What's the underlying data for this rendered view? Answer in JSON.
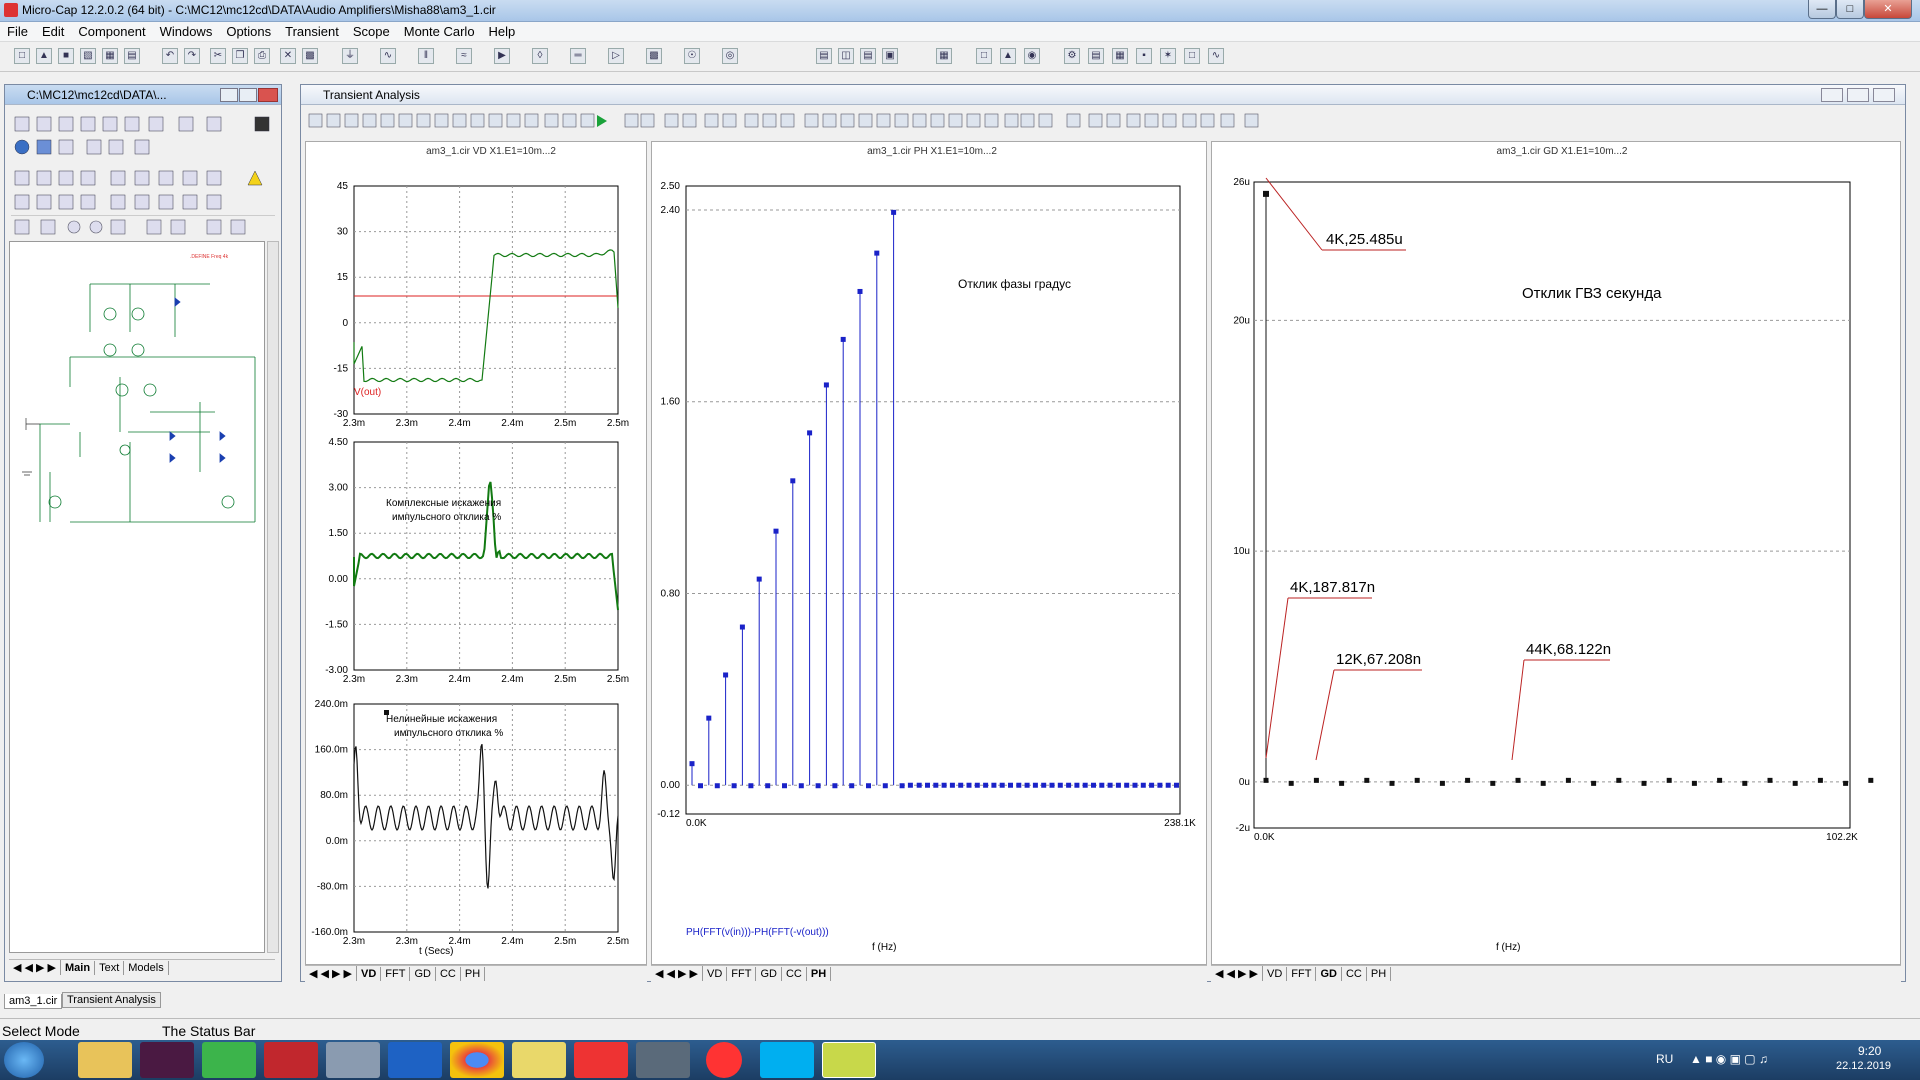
{
  "window": {
    "title": "Micro-Cap 12.2.0.2 (64 bit) - C:\\MC12\\mc12cd\\DATA\\Audio Amplifiers\\Misha88\\am3_1.cir"
  },
  "menu": [
    "File",
    "Edit",
    "Component",
    "Windows",
    "Options",
    "Transient",
    "Scope",
    "Monte Carlo",
    "Help"
  ],
  "schematic_window": {
    "title": "C:\\MC12\\mc12cd\\DATA\\...",
    "tabs": [
      "Main",
      "Text",
      "Models"
    ]
  },
  "transient_window": {
    "title": "Transient Analysis"
  },
  "plots": {
    "vd": {
      "title": "am3_1.cir VD X1.E1=10m...2",
      "y_ticks": [
        "45",
        "30",
        "15",
        "0",
        "-15",
        "-30"
      ],
      "x_ticks": [
        "2.3m",
        "2.3m",
        "2.4m",
        "2.4m",
        "2.5m",
        "2.5m"
      ],
      "trace_label": "V(out)"
    },
    "complex": {
      "annotation_line1": "Комплексные искажения",
      "annotation_line2": "импульсного отклика %",
      "y_ticks": [
        "4.50",
        "3.00",
        "1.50",
        "0.00",
        "-1.50",
        "-3.00"
      ],
      "x_ticks": [
        "2.3m",
        "2.3m",
        "2.4m",
        "2.4m",
        "2.5m",
        "2.5m"
      ]
    },
    "nonlinear": {
      "annotation_line1": "Нелинейные искажения",
      "annotation_line2": "импульсного отклика %",
      "y_ticks": [
        "240.0m",
        "160.0m",
        "80.0m",
        "0.0m",
        "-80.0m",
        "-160.0m"
      ],
      "x_ticks": [
        "2.3m",
        "2.3m",
        "2.4m",
        "2.4m",
        "2.5m",
        "2.5m"
      ],
      "xlabel": "t (Secs)"
    },
    "ph": {
      "title": "am3_1.cir PH X1.E1=10m...2",
      "y_ticks": [
        "2.50",
        "2.40",
        "1.60",
        "0.80",
        "0.00",
        "-0.12"
      ],
      "x_ticks": [
        "0.0K",
        "238.1K"
      ],
      "annotation": "Отклик фазы градус",
      "trace_label": "PH(FFT(v(in)))-PH(FFT(-v(out)))",
      "xlabel": "f (Hz)"
    },
    "gd": {
      "title": "am3_1.cir GD X1.E1=10m...2",
      "y_ticks": [
        "26u",
        "20u",
        "10u",
        "0u",
        "-2u"
      ],
      "x_ticks": [
        "0.0K",
        "102.2K"
      ],
      "annotation": "Отклик ГВЗ секунда",
      "labels": [
        "4K,25.485u",
        "4K,187.817n",
        "12K,67.208n",
        "44K,68.122n"
      ],
      "xlabel": "f (Hz)"
    }
  },
  "plot_tabs": [
    "VD",
    "FFT",
    "GD",
    "CC",
    "PH"
  ],
  "doc_tabs": [
    "am3_1.cir",
    "Transient Analysis"
  ],
  "status": {
    "mode": "Select Mode",
    "text": "The Status Bar"
  },
  "taskbar": {
    "lang": "RU",
    "time": "9:20",
    "date": "22.12.2019"
  },
  "chart_data": [
    {
      "type": "line",
      "title": "am3_1.cir VD X1.E1=10m...2",
      "series": [
        {
          "name": "V(out)",
          "x": [
            0.0023,
            0.00238,
            0.00239,
            0.0025
          ],
          "values": [
            -21,
            -21,
            21,
            21
          ]
        }
      ],
      "ylim": [
        -30,
        45
      ]
    },
    {
      "type": "line",
      "title": "am3_1.cir PH X1.E1=10m...2",
      "x": [
        0,
        4,
        8,
        12,
        16,
        20,
        24,
        28,
        32,
        36,
        40,
        44,
        48,
        52
      ],
      "values": [
        0.09,
        0.28,
        0.46,
        0.66,
        0.86,
        1.06,
        1.27,
        1.47,
        1.67,
        1.86,
        2.06,
        2.22,
        2.39,
        0.0
      ],
      "xlabel": "f (Hz)",
      "ylim": [
        -0.12,
        2.5
      ]
    },
    {
      "type": "scatter",
      "title": "am3_1.cir GD X1.E1=10m...2",
      "x": [
        4,
        4,
        12,
        44
      ],
      "values": [
        25.485,
        0.187817,
        0.067208,
        0.068122
      ],
      "xlabel": "f (Hz)",
      "ylim": [
        -2,
        26
      ]
    }
  ]
}
